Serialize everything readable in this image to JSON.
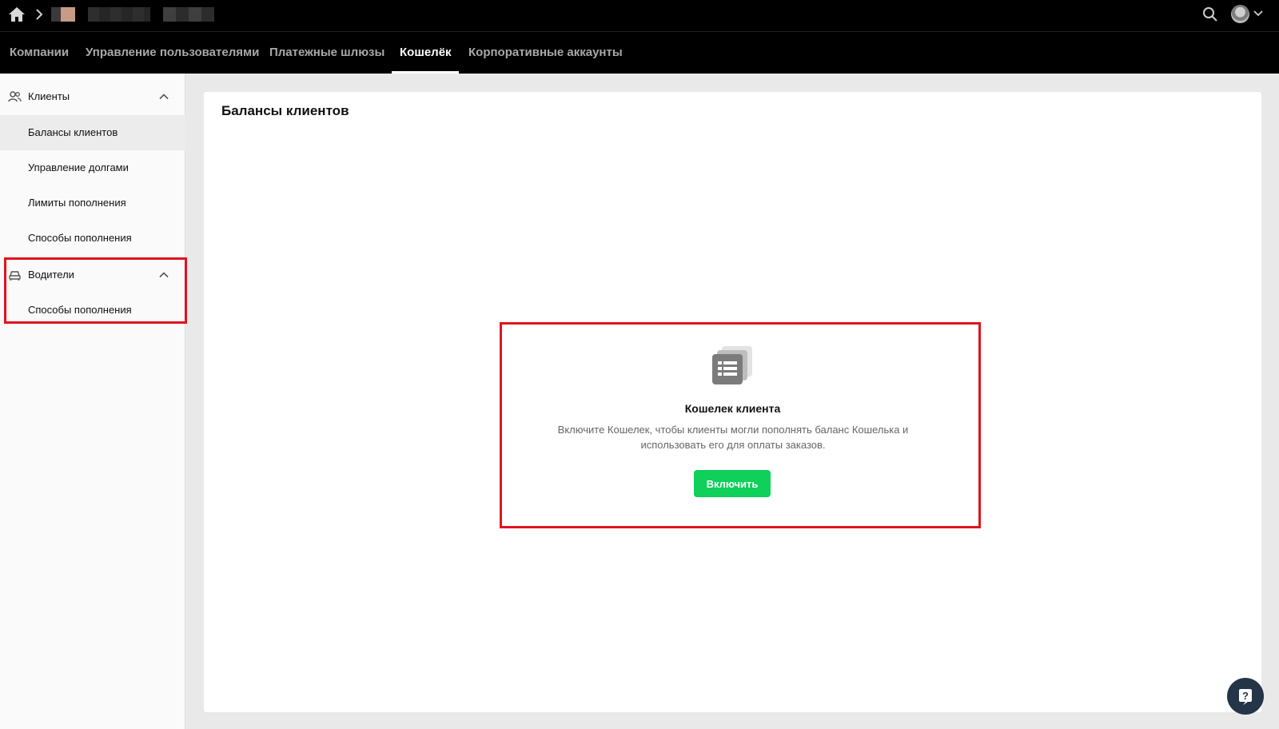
{
  "topbar": {
    "icons": [
      "home-icon",
      "chevron-right-icon",
      "search-icon",
      "avatar",
      "chevron-down-icon"
    ]
  },
  "nav": {
    "tabs": [
      {
        "label": "Компании"
      },
      {
        "label": "Управление пользователями"
      },
      {
        "label": "Платежные шлюзы"
      },
      {
        "label": "Кошелёк"
      },
      {
        "label": "Корпоративные аккаунты"
      }
    ],
    "active_tab": "Кошелёк"
  },
  "sidebar": {
    "groups": [
      {
        "label": "Клиенты",
        "icon": "users-icon",
        "expanded": true,
        "items": [
          "Балансы клиентов",
          "Управление долгами",
          "Лимиты пополнения",
          "Способы пополнения"
        ],
        "selected_item": "Балансы клиентов"
      },
      {
        "label": "Водители",
        "icon": "car-icon",
        "expanded": true,
        "items": [
          "Способы пополнения"
        ]
      }
    ]
  },
  "main": {
    "title": "Балансы клиентов",
    "empty_state": {
      "icon": "document-stack-icon",
      "title": "Кошелек клиента",
      "description": "Включите Кошелек, чтобы клиенты могли пополнять баланс Кошелька и использовать его для оплаты заказов.",
      "button_label": "Включить"
    }
  },
  "help": {
    "icon": "question-icon"
  },
  "colors": {
    "accent_green": "#0ed05b",
    "highlight_red": "#e0141e",
    "topbar_bg": "#000000",
    "help_bg": "#233547"
  }
}
